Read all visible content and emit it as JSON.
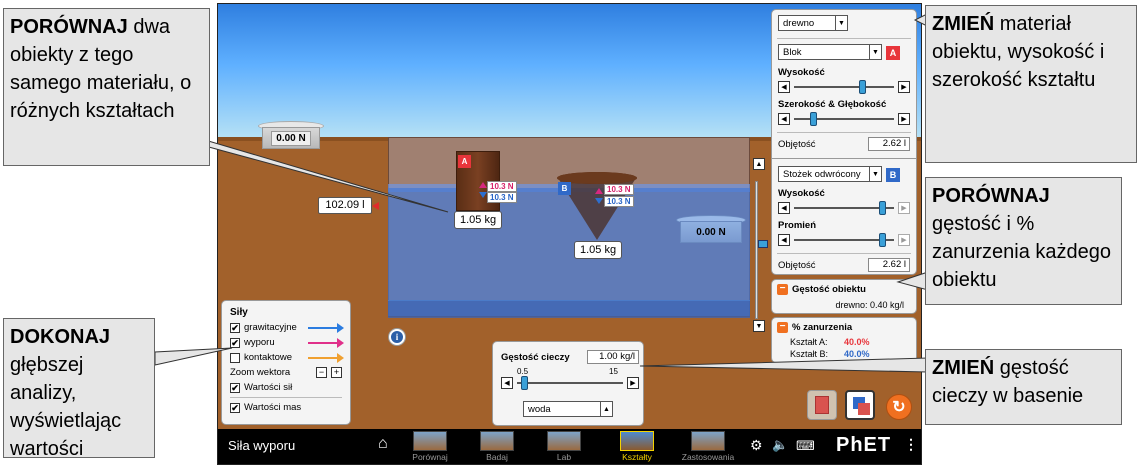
{
  "scene": {
    "scale_left_reading": "0.00 N",
    "scale_right_reading": "0.00 N",
    "volume_readout": "102.09 l",
    "block_a": {
      "tag": "A",
      "buoyant_force": "10.3 N",
      "gravity_force": "10.3 N",
      "mass": "1.05 kg"
    },
    "cone_b": {
      "tag": "B",
      "buoyant_force": "10.3 N",
      "gravity_force": "10.3 N",
      "mass": "1.05 kg"
    },
    "info_icon_glyph": "i"
  },
  "forces_panel": {
    "title": "Siły",
    "items": [
      {
        "label": "grawitacyjne",
        "checked": true,
        "color": "#2b7ce0"
      },
      {
        "label": "wyporu",
        "checked": true,
        "color": "#e0308a"
      },
      {
        "label": "kontaktowe",
        "checked": false,
        "color": "#f0a030"
      }
    ],
    "zoom_label": "Zoom wektora",
    "zoom_minus": "−",
    "zoom_plus": "+",
    "force_values_label": "Wartości sił",
    "mass_values_label": "Wartości mas",
    "check_glyph": "✔"
  },
  "fluid_panel": {
    "title": "Gęstość cieczy",
    "value": "1.00 kg/l",
    "min": "0.5",
    "max": "15",
    "fluid_select": "woda"
  },
  "object_panel": {
    "material_select": "drewno",
    "shape_a_select": "Blok",
    "tag_a": "A",
    "height_label": "Wysokość",
    "width_depth_label": "Szerokość & Głębokość",
    "volume_label": "Objętość",
    "volume_a": "2.62 l",
    "shape_b_select": "Stożek odwrócony",
    "tag_b": "B",
    "height_b_label": "Wysokość",
    "radius_label": "Promień",
    "volume_b": "2.62 l"
  },
  "density_panel": {
    "title": "Gęstość obiektu",
    "value": "drewno: 0.40 kg/l"
  },
  "submersion_panel": {
    "title": "% zanurzenia",
    "shape_a_label": "Kształt A:",
    "shape_a_value": "40.0%",
    "shape_b_label": "Kształt B:",
    "shape_b_value": "40.0%"
  },
  "navbar": {
    "title": "Siła wyporu",
    "screens": [
      "Porównaj",
      "Badaj",
      "Lab",
      "Kształty",
      "Zastosowania"
    ],
    "active_screen": "Kształty",
    "brand": "PhET"
  },
  "callouts": {
    "top_left": {
      "bold": "PORÓWNAJ",
      "text": " dwa obiekty z tego samego materiału, o różnych kształtach"
    },
    "bottom_left": {
      "bold": "DOKONAJ",
      "text": " głębszej analizy, wyświetlając wartości"
    },
    "top_right": {
      "bold": "ZMIEŃ",
      "text": " materiał obiektu, wysokość i szerokość kształtu"
    },
    "middle_right": {
      "bold": "PORÓWNAJ",
      "text": " gęstość i % zanurzenia każdego obiektu"
    },
    "bottom_right": {
      "bold": "ZMIEŃ",
      "text": " gęstość cieczy w basenie"
    }
  },
  "colors": {
    "accent_red": "#e8353b",
    "accent_blue": "#3069c8",
    "active_nav": "#f5d400",
    "reset_orange": "#f07020"
  }
}
